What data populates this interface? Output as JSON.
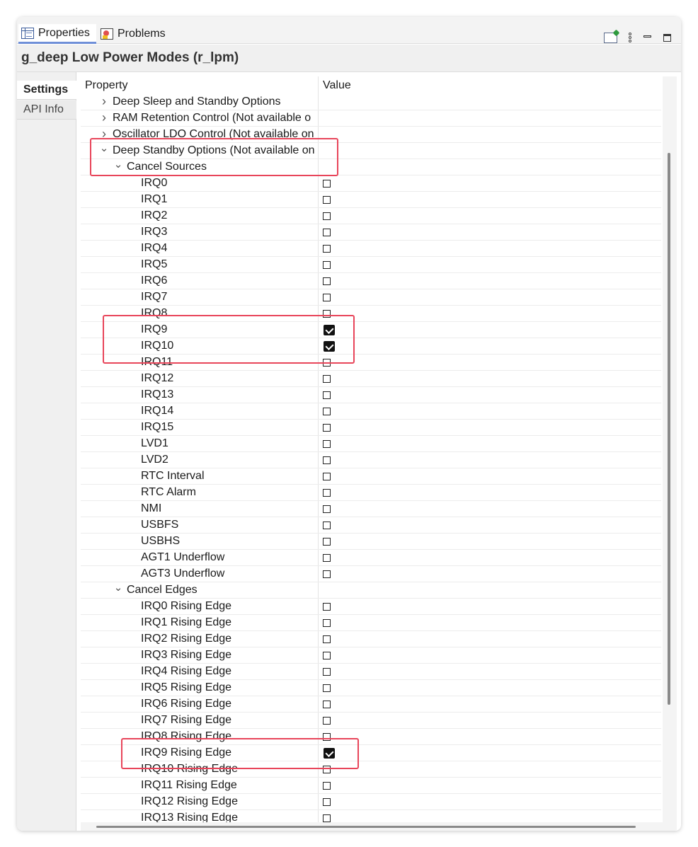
{
  "tabs": {
    "properties": "Properties",
    "problems": "Problems"
  },
  "title": "g_deep Low Power Modes (r_lpm)",
  "side_tabs": {
    "settings": "Settings",
    "api_info": "API Info"
  },
  "table": {
    "header_property": "Property",
    "header_value": "Value",
    "rows": [
      {
        "label": "Deep Sleep and Standby Options",
        "level": 0,
        "chevron": "collapsed",
        "checkbox": null
      },
      {
        "label": "RAM Retention Control (Not available o",
        "level": 0,
        "chevron": "collapsed",
        "checkbox": null
      },
      {
        "label": "Oscillator LDO Control (Not available on",
        "level": 0,
        "chevron": "collapsed",
        "checkbox": null
      },
      {
        "label": "Deep Standby Options (Not available on",
        "level": 0,
        "chevron": "expanded",
        "checkbox": null
      },
      {
        "label": "Cancel Sources",
        "level": 1,
        "chevron": "expanded",
        "checkbox": null
      },
      {
        "label": "IRQ0",
        "level": 2,
        "chevron": null,
        "checkbox": false
      },
      {
        "label": "IRQ1",
        "level": 2,
        "chevron": null,
        "checkbox": false
      },
      {
        "label": "IRQ2",
        "level": 2,
        "chevron": null,
        "checkbox": false
      },
      {
        "label": "IRQ3",
        "level": 2,
        "chevron": null,
        "checkbox": false
      },
      {
        "label": "IRQ4",
        "level": 2,
        "chevron": null,
        "checkbox": false
      },
      {
        "label": "IRQ5",
        "level": 2,
        "chevron": null,
        "checkbox": false
      },
      {
        "label": "IRQ6",
        "level": 2,
        "chevron": null,
        "checkbox": false
      },
      {
        "label": "IRQ7",
        "level": 2,
        "chevron": null,
        "checkbox": false
      },
      {
        "label": "IRQ8",
        "level": 2,
        "chevron": null,
        "checkbox": false
      },
      {
        "label": "IRQ9",
        "level": 2,
        "chevron": null,
        "checkbox": true
      },
      {
        "label": "IRQ10",
        "level": 2,
        "chevron": null,
        "checkbox": true
      },
      {
        "label": "IRQ11",
        "level": 2,
        "chevron": null,
        "checkbox": false
      },
      {
        "label": "IRQ12",
        "level": 2,
        "chevron": null,
        "checkbox": false
      },
      {
        "label": "IRQ13",
        "level": 2,
        "chevron": null,
        "checkbox": false
      },
      {
        "label": "IRQ14",
        "level": 2,
        "chevron": null,
        "checkbox": false
      },
      {
        "label": "IRQ15",
        "level": 2,
        "chevron": null,
        "checkbox": false
      },
      {
        "label": "LVD1",
        "level": 2,
        "chevron": null,
        "checkbox": false
      },
      {
        "label": "LVD2",
        "level": 2,
        "chevron": null,
        "checkbox": false
      },
      {
        "label": "RTC Interval",
        "level": 2,
        "chevron": null,
        "checkbox": false
      },
      {
        "label": "RTC Alarm",
        "level": 2,
        "chevron": null,
        "checkbox": false
      },
      {
        "label": "NMI",
        "level": 2,
        "chevron": null,
        "checkbox": false
      },
      {
        "label": "USBFS",
        "level": 2,
        "chevron": null,
        "checkbox": false
      },
      {
        "label": "USBHS",
        "level": 2,
        "chevron": null,
        "checkbox": false
      },
      {
        "label": "AGT1 Underflow",
        "level": 2,
        "chevron": null,
        "checkbox": false
      },
      {
        "label": "AGT3 Underflow",
        "level": 2,
        "chevron": null,
        "checkbox": false
      },
      {
        "label": "Cancel Edges",
        "level": 1,
        "chevron": "expanded",
        "checkbox": null
      },
      {
        "label": "IRQ0 Rising Edge",
        "level": 2,
        "chevron": null,
        "checkbox": false
      },
      {
        "label": "IRQ1 Rising Edge",
        "level": 2,
        "chevron": null,
        "checkbox": false
      },
      {
        "label": "IRQ2 Rising Edge",
        "level": 2,
        "chevron": null,
        "checkbox": false
      },
      {
        "label": "IRQ3 Rising Edge",
        "level": 2,
        "chevron": null,
        "checkbox": false
      },
      {
        "label": "IRQ4 Rising Edge",
        "level": 2,
        "chevron": null,
        "checkbox": false
      },
      {
        "label": "IRQ5 Rising Edge",
        "level": 2,
        "chevron": null,
        "checkbox": false
      },
      {
        "label": "IRQ6 Rising Edge",
        "level": 2,
        "chevron": null,
        "checkbox": false
      },
      {
        "label": "IRQ7 Rising Edge",
        "level": 2,
        "chevron": null,
        "checkbox": false
      },
      {
        "label": "IRQ8 Rising Edge",
        "level": 2,
        "chevron": null,
        "checkbox": false
      },
      {
        "label": "IRQ9 Rising Edge",
        "level": 2,
        "chevron": null,
        "checkbox": true
      },
      {
        "label": "IRQ10 Rising Edge",
        "level": 2,
        "chevron": null,
        "checkbox": false
      },
      {
        "label": "IRQ11 Rising Edge",
        "level": 2,
        "chevron": null,
        "checkbox": false
      },
      {
        "label": "IRQ12 Rising Edge",
        "level": 2,
        "chevron": null,
        "checkbox": false
      },
      {
        "label": "IRQ13 Rising Edge",
        "level": 2,
        "chevron": null,
        "checkbox": false
      }
    ]
  },
  "icons": {
    "properties_tab": "properties-table-icon",
    "problems_tab": "problems-icon",
    "pin": "pin-to-view-icon",
    "menu": "view-menu-icon",
    "minimize": "minimize-icon",
    "maximize": "maximize-icon",
    "collapsed": "chevron-right-icon",
    "expanded": "chevron-down-icon"
  },
  "colors": {
    "highlight": "#e8455a",
    "active_tab_underline": "#6f8fd8",
    "checkbox_checked": "#111111"
  }
}
